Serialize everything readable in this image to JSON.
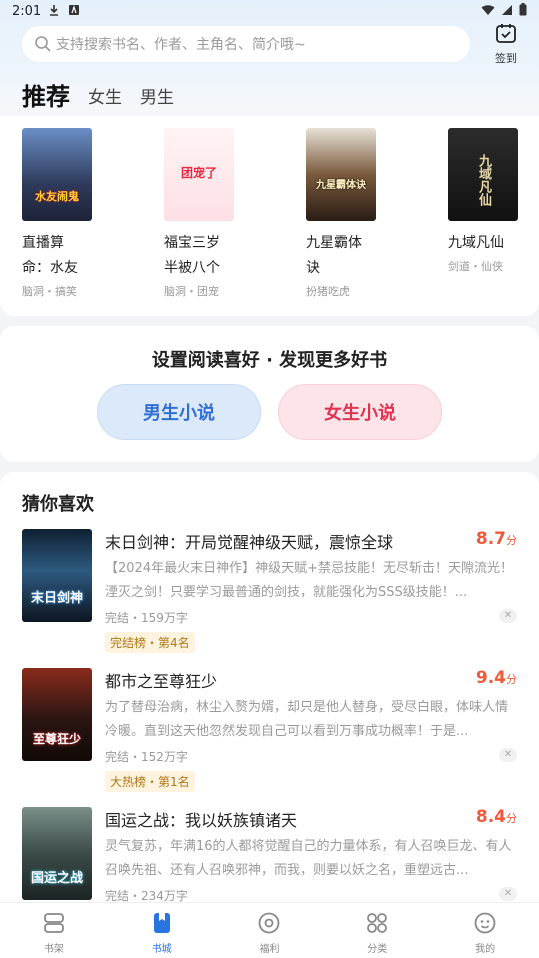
{
  "status": {
    "time": "2:01"
  },
  "search": {
    "placeholder": "支持搜索书名、作者、主角名、简介哦~",
    "icon": "search-icon"
  },
  "signin": {
    "label": "签到",
    "icon": "calendar-check-icon"
  },
  "tabs": [
    {
      "label": "推荐",
      "active": true
    },
    {
      "label": "女生",
      "active": false
    },
    {
      "label": "男生",
      "active": false
    }
  ],
  "recommend": [
    {
      "title": "直播算命：水友",
      "tags": "脑洞・搞笑",
      "cover_text": "水友闹鬼",
      "cover_color": "#3a4a6a"
    },
    {
      "title": "福宝三岁半被八个",
      "tags": "脑洞・团宠",
      "cover_text": "团宠了",
      "cover_color": "#fce3e6"
    },
    {
      "title": "九星霸体诀",
      "tags": "扮猪吃虎",
      "cover_text": "九星霸体诀",
      "cover_color": "#3b2d22"
    },
    {
      "title": "九域凡仙",
      "tags": "剑道・仙侠",
      "cover_text": "九域凡仙",
      "cover_color": "#1e1e1e"
    }
  ],
  "preference": {
    "title": "设置阅读喜好 · 发现更多好书",
    "male_label": "男生小说",
    "female_label": "女生小说"
  },
  "guess": {
    "title": "猜你喜欢",
    "books": [
      {
        "title": "末日剑神：开局觉醒神级天赋，震惊全球",
        "score": "8.7",
        "score_unit": "分",
        "desc": "【2024年最火末日神作】神级天赋+禁忌技能！无尽斩击！天隙流光！湮灭之剑！只要学习最普通的剑技，就能强化为SSS级技能！...",
        "meta": "完结・159万字",
        "rank": "完结榜・第4名",
        "cover_text": "末日剑神",
        "cover_color": "#1f3a55"
      },
      {
        "title": "都市之至尊狂少",
        "score": "9.4",
        "score_unit": "分",
        "desc": "为了替母治病，林尘入赘为婿，却只是他人替身，受尽白眼，体味人情冷暖。直到这天他忽然发现自己可以看到万事成功概率！于是...",
        "meta": "完结・152万字",
        "rank": "大热榜・第1名",
        "cover_text": "至尊狂少",
        "cover_color": "#4a1a1a"
      },
      {
        "title": "国运之战：我以妖族镇诸天",
        "score": "8.4",
        "score_unit": "分",
        "desc": "灵气复苏，年满16的人都将觉醒自己的力量体系，有人召唤巨龙、有人召唤先祖、还有人召唤邪神，而我，则要以妖之名，重塑远古...",
        "meta": "完结・234万字",
        "rank": "",
        "cover_text": "国运之战",
        "cover_color": "#2e3f3a"
      }
    ]
  },
  "nav": [
    {
      "label": "书架",
      "icon": "bookshelf-icon",
      "active": false
    },
    {
      "label": "书城",
      "icon": "bookstore-icon",
      "active": true
    },
    {
      "label": "福利",
      "icon": "welfare-icon",
      "active": false
    },
    {
      "label": "分类",
      "icon": "category-icon",
      "active": false
    },
    {
      "label": "我的",
      "icon": "profile-icon",
      "active": false
    }
  ]
}
